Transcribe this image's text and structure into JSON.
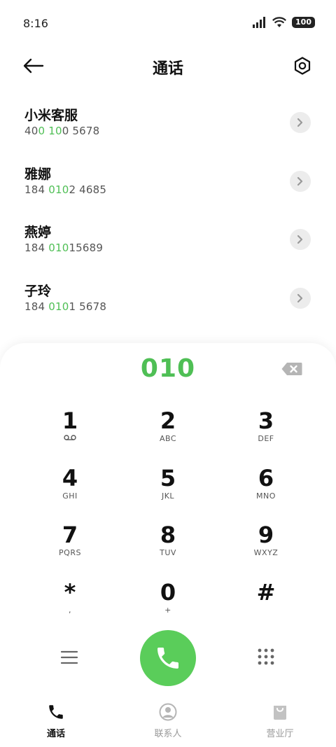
{
  "status_bar": {
    "time": "8:16",
    "battery": "100"
  },
  "header": {
    "title": "通话"
  },
  "contacts": [
    {
      "name": "小米客服",
      "number_parts": [
        "40",
        "0",
        " ",
        "10",
        "0 5678"
      ]
    },
    {
      "name": "雅娜",
      "number_parts": [
        "184 ",
        "010",
        "2 4685"
      ]
    },
    {
      "name": "燕婷",
      "number_parts": [
        "184 ",
        "010",
        "15689"
      ]
    },
    {
      "name": "子玲",
      "number_parts": [
        "184 ",
        "010",
        "1 5678"
      ]
    }
  ],
  "dialer": {
    "number": "010",
    "keys": [
      {
        "digit": "1",
        "sub": ""
      },
      {
        "digit": "2",
        "sub": "ABC"
      },
      {
        "digit": "3",
        "sub": "DEF"
      },
      {
        "digit": "4",
        "sub": "GHI"
      },
      {
        "digit": "5",
        "sub": "JKL"
      },
      {
        "digit": "6",
        "sub": "MNO"
      },
      {
        "digit": "7",
        "sub": "PQRS"
      },
      {
        "digit": "8",
        "sub": "TUV"
      },
      {
        "digit": "9",
        "sub": "WXYZ"
      },
      {
        "digit": "*",
        "sub": ","
      },
      {
        "digit": "0",
        "sub": "+"
      },
      {
        "digit": "#",
        "sub": ""
      }
    ]
  },
  "bottom_nav": [
    {
      "label": "通话",
      "icon": "phone-icon",
      "active": true
    },
    {
      "label": "联系人",
      "icon": "contact-person-icon",
      "active": false
    },
    {
      "label": "营业厅",
      "icon": "shopping-bag-icon",
      "active": false
    }
  ],
  "colors": {
    "accent": "#4fbf55",
    "call_button": "#5acd5a"
  }
}
